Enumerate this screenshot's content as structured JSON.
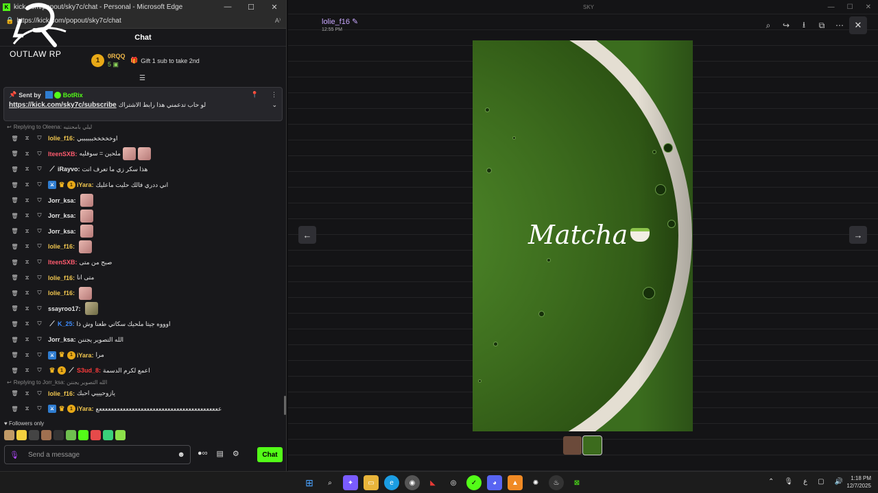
{
  "edge": {
    "title": "kick.com/popout/sky7c/chat - Personal - Microsoft Edge",
    "url": "https://kick.com/popout/sky7c/chat",
    "min": "—",
    "max": "☐",
    "close": "✕"
  },
  "chat": {
    "header": "Chat",
    "logo_text": "OUTLAW RP",
    "top_gifter": {
      "rank": "1",
      "name": "0RQQ",
      "count": "5"
    },
    "gift_prompt": "Gift 1 sub to take 2nd",
    "pinned": {
      "sent_by_label": "Sent by",
      "sender": "BotRix",
      "link": "https://kick.com/sky7c/subscribe",
      "text": "لو حاب تدعمني هذا رابط الاشتراك"
    },
    "messages": [
      {
        "reply_to": "Replying to Oleena: ليلي بامحنتيه"
      },
      {
        "user": "lolie_f16:",
        "color": "#f0c64f",
        "text": "اوخخخخخببببببي",
        "badges": []
      },
      {
        "user": "lteenSXB:",
        "color": "#ff5b6e",
        "text": "ملحين = سوفليه",
        "badges": [],
        "emotes": 2
      },
      {
        "user": "iRayvo:",
        "color": "#e6e6e6",
        "text": "هذا سكر زي ما تعرف انت",
        "badges": [
          "k"
        ]
      },
      {
        "user": "iYara:",
        "color": "#f0c64f",
        "text": "اني ددري فالك حليت ماعليك",
        "badges": [
          "b",
          "c",
          "g"
        ]
      },
      {
        "user": "Jorr_ksa:",
        "color": "#e6e6e6",
        "text": "",
        "badges": [],
        "emotes": 1
      },
      {
        "user": "Jorr_ksa:",
        "color": "#e6e6e6",
        "text": "",
        "badges": [],
        "emotes": 1
      },
      {
        "user": "Jorr_ksa:",
        "color": "#e6e6e6",
        "text": "",
        "badges": [],
        "emotes": 1
      },
      {
        "user": "lolie_f16:",
        "color": "#f0c64f",
        "text": "",
        "badges": [],
        "emotes": 1
      },
      {
        "user": "lteenSXB:",
        "color": "#ff5b6e",
        "text": "صبح من متى",
        "badges": []
      },
      {
        "user": "lolie_f16:",
        "color": "#f0c64f",
        "text": "متى انا",
        "badges": []
      },
      {
        "user": "lolie_f16:",
        "color": "#f0c64f",
        "text": "",
        "badges": [],
        "emotes": 1
      },
      {
        "user": "ssayroo17:",
        "color": "#e6e6e6",
        "text": "",
        "badges": [],
        "emotes": 1,
        "emote_style": "g"
      },
      {
        "user": "K_25:",
        "color": "#3d8bfd",
        "text": "اوووه جيتا ملحيك سكاتي طعنا وش ذا",
        "badges": [
          "k"
        ]
      },
      {
        "user": "Jorr_ksa:",
        "color": "#e6e6e6",
        "text": "الله التصوير يجننن",
        "badges": []
      },
      {
        "user": "iYara:",
        "color": "#f0c64f",
        "text": "مرا",
        "badges": [
          "b",
          "c",
          "g"
        ]
      },
      {
        "user": "S3ud_8:",
        "color": "#ff3b3b",
        "text": "اعمع لكرم الدسمة",
        "badges": [
          "c",
          "g",
          "k"
        ]
      },
      {
        "reply_to": "Replying to Jorr_ksa: الله التصوير يجننن"
      },
      {
        "user": "lolie_f16:",
        "color": "#f0c64f",
        "text": "يازوحيييي احبك",
        "badges": []
      },
      {
        "user": "iYara:",
        "color": "#f0c64f",
        "text": "عععععععععععععععععععععععععععععععععععععععععع",
        "badges": [
          "b",
          "c",
          "g"
        ]
      }
    ],
    "followers_only": "Followers only",
    "input_placeholder": "Send a message",
    "send_button": "Chat"
  },
  "viewer": {
    "window_title": "SKY",
    "author": "lolie_f16 ✎",
    "time": "12:55 PM",
    "caption": "Matcha",
    "tools": [
      "zoom-in-icon",
      "forward-icon",
      "download-icon",
      "open-external-icon",
      "more-icon"
    ]
  },
  "taskbar": {
    "lang": "ع",
    "time": "1:18 PM",
    "date": "12/7/2025"
  }
}
